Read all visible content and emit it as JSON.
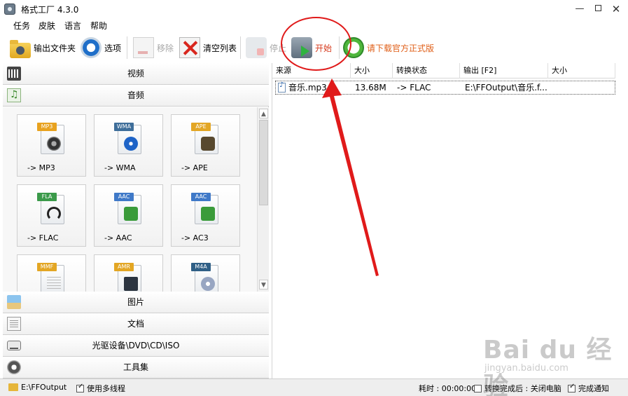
{
  "window": {
    "title": "格式工厂 4.3.0"
  },
  "menu": [
    "任务",
    "皮肤",
    "语言",
    "帮助"
  ],
  "toolbar": {
    "output_folder": "输出文件夹",
    "options": "选项",
    "remove": "移除",
    "clear_list": "清空列表",
    "stop": "停止",
    "start": "开始",
    "download": "请下载官方正式版"
  },
  "categories": {
    "video": "视频",
    "audio": "音频",
    "picture": "图片",
    "document": "文档",
    "disc": "光驱设备\\DVD\\CD\\ISO",
    "tools": "工具集"
  },
  "formats": [
    {
      "badge": "MP3",
      "label": "-> MP3",
      "badge_color": "#e8a21f"
    },
    {
      "badge": "WMA",
      "label": "-> WMA",
      "badge_color": "#3e6e9a"
    },
    {
      "badge": "APE",
      "label": "-> APE",
      "badge_color": "#e3a624"
    },
    {
      "badge": "FLA",
      "label": "-> FLAC",
      "badge_color": "#3b9a4a"
    },
    {
      "badge": "AAC",
      "label": "-> AAC",
      "badge_color": "#3f79c8"
    },
    {
      "badge": "AAC",
      "label": "-> AC3",
      "badge_color": "#3f79c8"
    },
    {
      "badge": "MMF",
      "label": "",
      "badge_color": "#e3a624"
    },
    {
      "badge": "AMR",
      "label": "",
      "badge_color": "#e3a624"
    },
    {
      "badge": "M4A",
      "label": "",
      "badge_color": "#2f5f86"
    }
  ],
  "file_list": {
    "columns": [
      "来源",
      "大小",
      "转换状态",
      "输出 [F2]",
      "大小"
    ],
    "rows": [
      {
        "source": "音乐.mp3",
        "size": "13.68M",
        "status": "-> FLAC",
        "output": "E:\\FFOutput\\音乐.f...",
        "out_size": ""
      }
    ]
  },
  "status": {
    "folder": "E:\\FFOutput",
    "multithread": "使用多线程",
    "elapsed": "耗时 : 00:00:00",
    "after_convert": "转换完成后 : 关闭电脑",
    "notify": "完成通知"
  },
  "watermark": {
    "logo": "Bai du 经验",
    "url": "jingyan.baidu.com"
  },
  "colors": {
    "annotation": "#e01a1a",
    "start_text": "#d63b1e",
    "download_text": "#e0601a"
  }
}
